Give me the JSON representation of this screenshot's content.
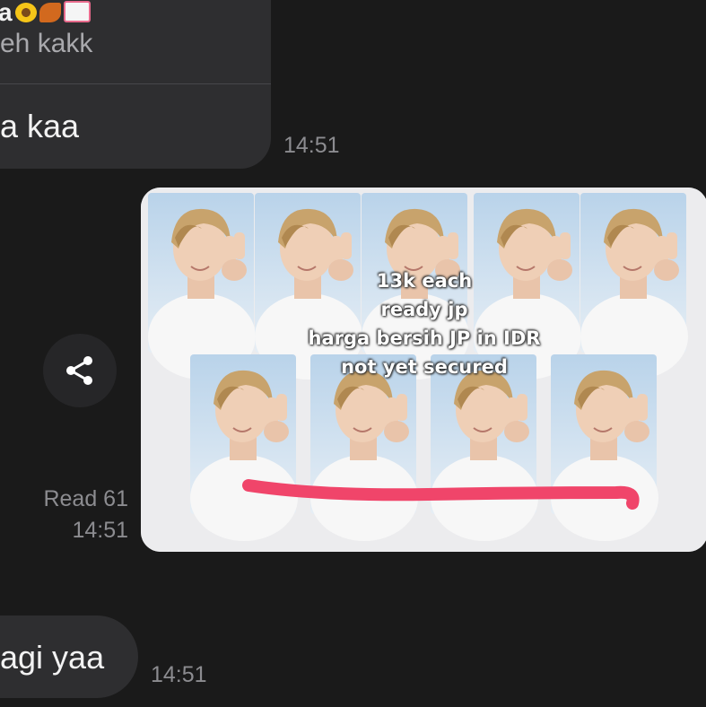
{
  "messages": {
    "top": {
      "quote_name": "a",
      "quote_emojis": [
        "sunflower-emoji",
        "maple-leaf-emoji",
        "love-letter-emoji"
      ],
      "quote_text": "eh kakk",
      "text": "a kaa",
      "time": "14:51"
    },
    "image": {
      "caption_lines": [
        "13k each",
        "ready jp",
        "harga bersih JP in IDR",
        "not yet secured"
      ],
      "read_label": "Read 61",
      "time": "14:51"
    },
    "bottom": {
      "text": "agi yaa",
      "time": "14:51"
    }
  },
  "icons": {
    "share": "share-icon"
  },
  "colors": {
    "background": "#1a1a1a",
    "bubble": "#2e2e30",
    "text": "#f2f2f2",
    "meta": "#8c8c90",
    "highlight_stroke": "#f0456a"
  }
}
